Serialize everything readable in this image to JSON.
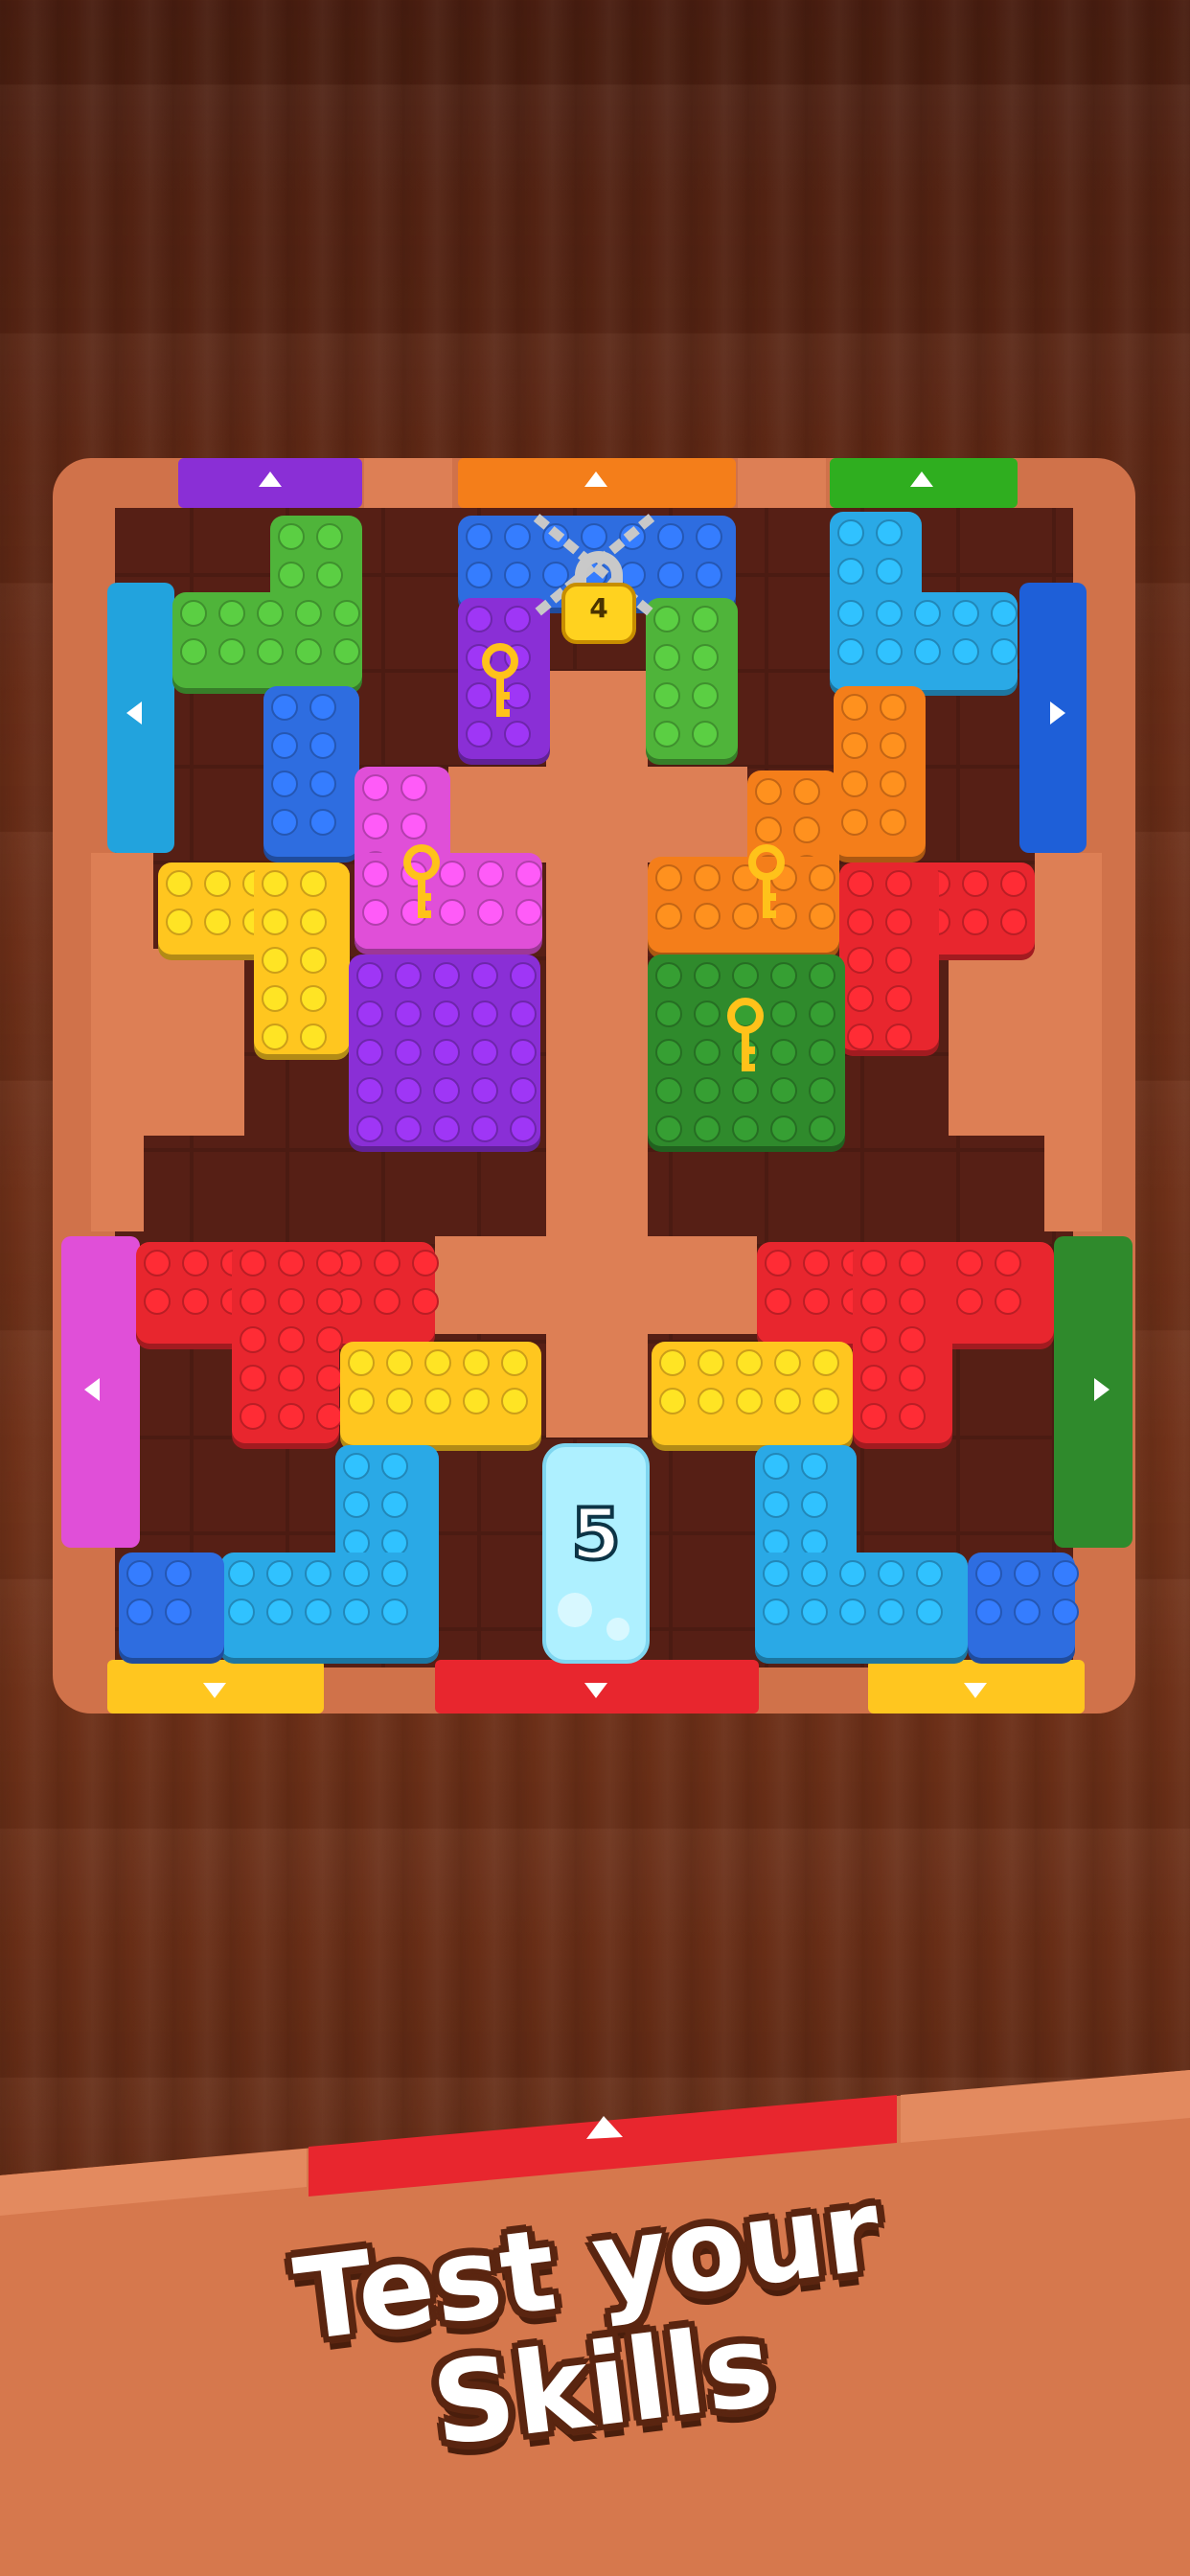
{
  "tagline": {
    "line1": "Test your",
    "line2": "Skills"
  },
  "lock": {
    "count": "4",
    "icon": "padlock-icon"
  },
  "ice_block": {
    "count": "5"
  },
  "icons": {
    "key": "key-icon",
    "exit_arrow": "triangle-arrow-icon",
    "chain": "chain-icon"
  },
  "colors": {
    "red": "#e8262e",
    "blue": "#2e6de0",
    "light_blue": "#2aa9e6",
    "yellow": "#ffc61f",
    "green": "#4fb43a",
    "dark_green": "#2f8a2c",
    "purple": "#8a2fd6",
    "pink": "#e04fd8",
    "orange": "#f47e1a",
    "wall": "#dd7f55",
    "cell": "#4a1a12",
    "ice": "#aef0ff"
  }
}
